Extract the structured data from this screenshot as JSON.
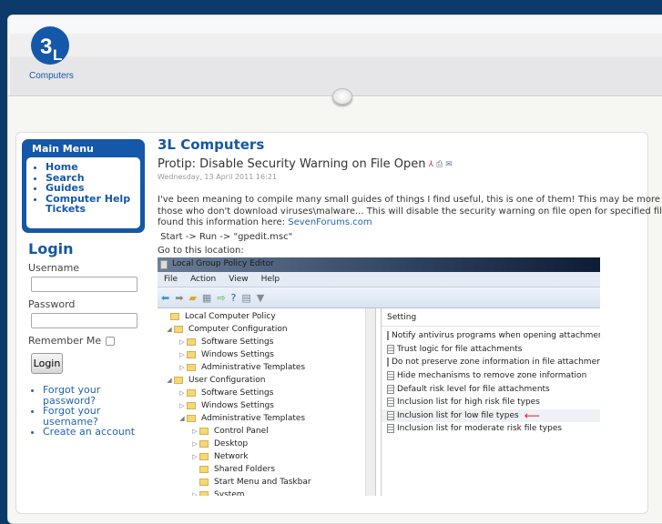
{
  "logo": {
    "text_top": "3L",
    "text_bottom": "Computers",
    "color": "#1557a8"
  },
  "main_menu": {
    "title": "Main Menu",
    "items": [
      "Home",
      "Search",
      "Guides",
      "Computer Help Tickets"
    ]
  },
  "login": {
    "title": "Login",
    "username_label": "Username",
    "username_value": "",
    "password_label": "Password",
    "password_value": "",
    "remember_label": "Remember Me",
    "remember_checked": false,
    "button": "Login",
    "links": [
      "Forgot your password?",
      "Forgot your username?",
      "Create an account"
    ]
  },
  "article": {
    "site_title": "3L Computers",
    "title": "Protip: Disable Security Warning on File Open",
    "icons": [
      "pdf-icon",
      "print-icon",
      "email-icon"
    ],
    "date": "Wednesday, 13 April 2011 16:21",
    "para1_line1": "I've been meaning to compile many small guides of things I find useful, this is one of them! This may be more for",
    "para1_line2": "those who don't download viruses\\malware... This will disable the security warning on file open for specified files. I",
    "para1_line3": "found this information here: ",
    "link": "SevenForums.com",
    "step": " Start -> Run -> \"gpedit.msc\"",
    "goto": "Go to this location:"
  },
  "screenshot": {
    "window_title": "Local Group Policy Editor",
    "menu": [
      "File",
      "Action",
      "View",
      "Help"
    ],
    "tree": [
      {
        "label": "Local Computer Policy",
        "level": 0,
        "arrow": ""
      },
      {
        "label": "Computer Configuration",
        "level": 1,
        "arrow": "◢"
      },
      {
        "label": "Software Settings",
        "level": 2,
        "arrow": "▷"
      },
      {
        "label": "Windows Settings",
        "level": 2,
        "arrow": "▷"
      },
      {
        "label": "Administrative Templates",
        "level": 2,
        "arrow": "▷"
      },
      {
        "label": "User Configuration",
        "level": 1,
        "arrow": "◢"
      },
      {
        "label": "Software Settings",
        "level": 2,
        "arrow": "▷"
      },
      {
        "label": "Windows Settings",
        "level": 2,
        "arrow": "▷"
      },
      {
        "label": "Administrative Templates",
        "level": 2,
        "arrow": "◢"
      },
      {
        "label": "Control Panel",
        "level": 3,
        "arrow": "▷"
      },
      {
        "label": "Desktop",
        "level": 3,
        "arrow": "▷"
      },
      {
        "label": "Network",
        "level": 3,
        "arrow": "▷"
      },
      {
        "label": "Shared Folders",
        "level": 3,
        "arrow": ""
      },
      {
        "label": "Start Menu and Taskbar",
        "level": 3,
        "arrow": ""
      },
      {
        "label": "System",
        "level": 3,
        "arrow": "▷"
      }
    ],
    "column_header": "Setting",
    "settings": [
      "Notify antivirus programs when opening attachments",
      "Trust logic for file attachments",
      "Do not preserve zone information in file attachments",
      "Hide mechanisms to remove zone information",
      "Default risk level for file attachments",
      "Inclusion list for high risk file types",
      "Inclusion list for low file types",
      "Inclusion list for moderate risk file types"
    ],
    "highlighted_setting": "Inclusion list for low file types"
  }
}
